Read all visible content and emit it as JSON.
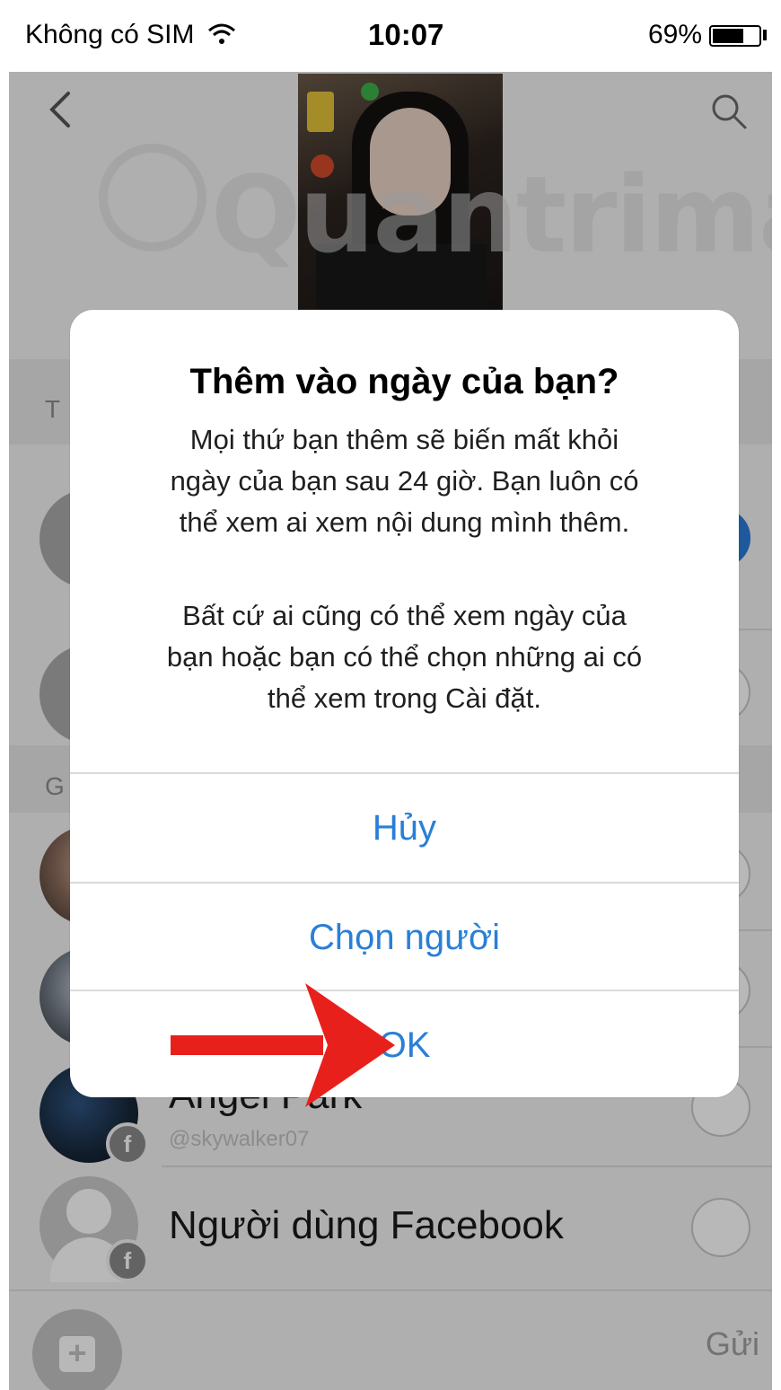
{
  "status_bar": {
    "carrier": "Không có SIM",
    "time": "10:07",
    "battery": "69%"
  },
  "header": {
    "back_icon": "chevron-left-icon",
    "search_icon": "search-icon"
  },
  "watermark": {
    "text": "Quantrimang"
  },
  "list": {
    "section_a_letter": "T",
    "section_b_letter": "G",
    "contacts": [
      {
        "name": "Angel Park",
        "sub": "@skywalker07"
      },
      {
        "name": "Người dùng Facebook",
        "sub": ""
      }
    ]
  },
  "alert": {
    "title": "Thêm vào ngày của bạn?",
    "message_lines_1": [
      "Mọi thứ bạn thêm sẽ biến mất khỏi",
      "ngày của bạn sau 24 giờ. Bạn luôn có",
      "thể xem ai xem nội dung mình thêm."
    ],
    "message_lines_2": [
      "Bất cứ ai cũng có thể xem ngày của",
      "bạn hoặc bạn có thể chọn những ai có",
      "thể xem trong Cài đặt."
    ],
    "buttons": {
      "cancel": "Hủy",
      "choose_people": "Chọn người",
      "ok": "OK"
    }
  },
  "bottom_bar": {
    "send_label": "Gửi"
  },
  "colors": {
    "accent": "#2a7fd6",
    "arrow": "#e8201c"
  }
}
